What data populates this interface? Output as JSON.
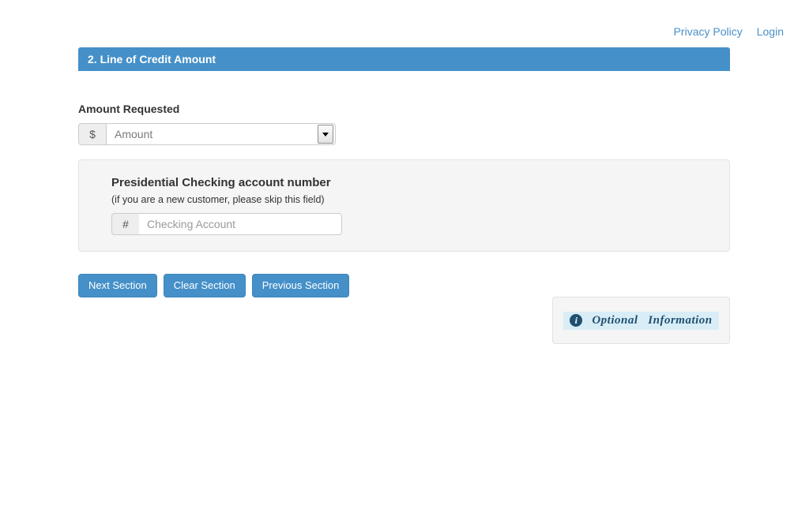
{
  "topnav": {
    "links": [
      {
        "label": "Privacy Policy",
        "name": "privacy-policy-link"
      },
      {
        "label": "Login",
        "name": "login-link"
      }
    ]
  },
  "section": {
    "header_title": "2. Line of Credit Amount",
    "header_bg": "#4590c8",
    "header_text_color": "#ffffff"
  },
  "amount": {
    "label": "Amount Requested",
    "currency_addon": "$",
    "select_value": "Amount",
    "dropdown_icon": "chevron-down-icon"
  },
  "checking": {
    "title": "Presidential Checking account number",
    "subtitle": "(if you are a new customer, please skip this field)",
    "hash_addon": "#",
    "input_value": "",
    "input_placeholder": "Checking Account"
  },
  "buttons": {
    "next": "Next Section",
    "clear": "Clear Section",
    "previous": "Previous Section",
    "accent": "#4590c8"
  },
  "info": {
    "icon": "info-circle-icon",
    "icon_glyph": "i",
    "text": "Optional   Information",
    "highlight_bg": "#d9edf7",
    "text_color": "#1f5070"
  }
}
